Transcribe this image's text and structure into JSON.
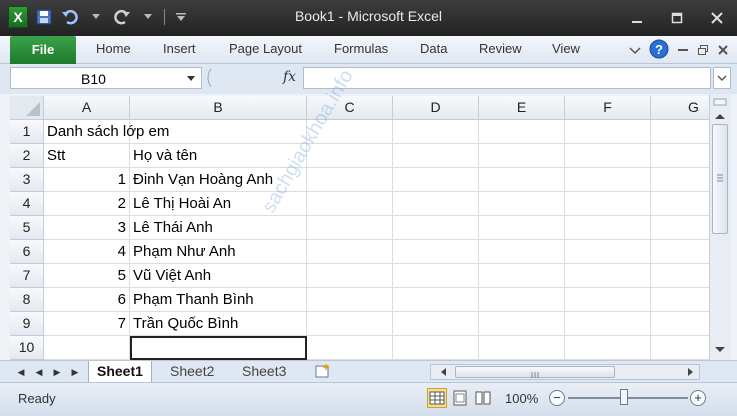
{
  "window": {
    "title": "Book1  -  Microsoft Excel",
    "app_icon": "X"
  },
  "ribbon": {
    "file_label": "File",
    "tabs": [
      "Home",
      "Insert",
      "Page Layout",
      "Formulas",
      "Data",
      "Review",
      "View"
    ]
  },
  "formula_bar": {
    "name_box": "B10",
    "fx_label": "fx",
    "formula_value": ""
  },
  "columns": [
    "A",
    "B",
    "C",
    "D",
    "E",
    "F",
    "G"
  ],
  "rows": [
    {
      "num": "1",
      "a": "Danh sách lớp em",
      "b": ""
    },
    {
      "num": "2",
      "a": "Stt",
      "b": "Họ và tên"
    },
    {
      "num": "3",
      "a": "1",
      "b": "Đinh Vạn Hoàng Anh"
    },
    {
      "num": "4",
      "a": "2",
      "b": "Lê Thị Hoài An"
    },
    {
      "num": "5",
      "a": "3",
      "b": "Lê Thái Anh"
    },
    {
      "num": "6",
      "a": "4",
      "b": "Phạm Như Anh"
    },
    {
      "num": "7",
      "a": "5",
      "b": "Vũ Việt Anh"
    },
    {
      "num": "8",
      "a": "6",
      "b": "Phạm Thanh Bình"
    },
    {
      "num": "9",
      "a": "7",
      "b": "Trần Quốc Bình"
    },
    {
      "num": "10",
      "a": "",
      "b": ""
    }
  ],
  "watermark": "sachgiaokhoa.info",
  "sheets": {
    "tabs": [
      "Sheet1",
      "Sheet2",
      "Sheet3"
    ],
    "active": "Sheet1"
  },
  "status": {
    "ready": "Ready",
    "zoom": "100%",
    "zoom_minus": "−",
    "zoom_plus": "+"
  },
  "colors": {
    "file_tab": "#2a8f3b",
    "title_bar": "#2e2e2e",
    "help": "#2a6fd6"
  }
}
